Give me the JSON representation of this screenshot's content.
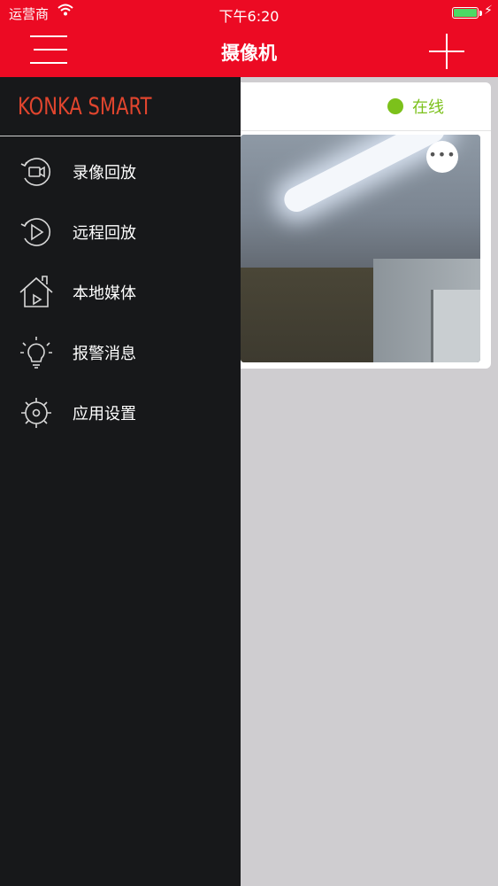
{
  "status_bar": {
    "carrier": "运营商",
    "time": "下午6:20"
  },
  "header": {
    "title": "摄像机",
    "menu_icon": "hamburger-icon",
    "add_icon": "plus-icon"
  },
  "camera_card": {
    "status": "在线",
    "status_color": "#7cc11b",
    "more_label": "•••"
  },
  "drawer": {
    "brand": "KONKA SMART",
    "brand_color": "#e0452e",
    "items": [
      {
        "label": "录像回放",
        "icon": "video-replay-icon"
      },
      {
        "label": "远程回放",
        "icon": "remote-replay-icon"
      },
      {
        "label": "本地媒体",
        "icon": "home-media-icon"
      },
      {
        "label": "报警消息",
        "icon": "alarm-bulb-icon"
      },
      {
        "label": "应用设置",
        "icon": "settings-gear-icon"
      }
    ]
  },
  "colors": {
    "header_bg": "#ec0a23",
    "drawer_bg": "#17181a",
    "page_bg": "#cfcdd0"
  }
}
